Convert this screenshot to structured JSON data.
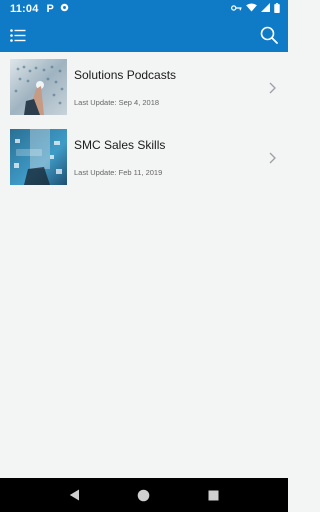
{
  "status_bar": {
    "time": "11:04",
    "icons": [
      "p-notification-icon",
      "settings-notification-icon",
      "key-icon",
      "wifi-icon",
      "signal-icon",
      "battery-icon"
    ]
  },
  "app_bar": {
    "menu_icon": "list-menu-icon",
    "search_icon": "search-icon",
    "color": "#0f7ac6"
  },
  "items": [
    {
      "title": "Solutions Podcasts",
      "date": "Last Update: Sep 4, 2018"
    },
    {
      "title": "SMC Sales Skills",
      "date": "Last Update: Feb 11, 2019"
    }
  ],
  "nav": {
    "icons": [
      "back-icon",
      "home-icon",
      "recents-icon"
    ]
  }
}
